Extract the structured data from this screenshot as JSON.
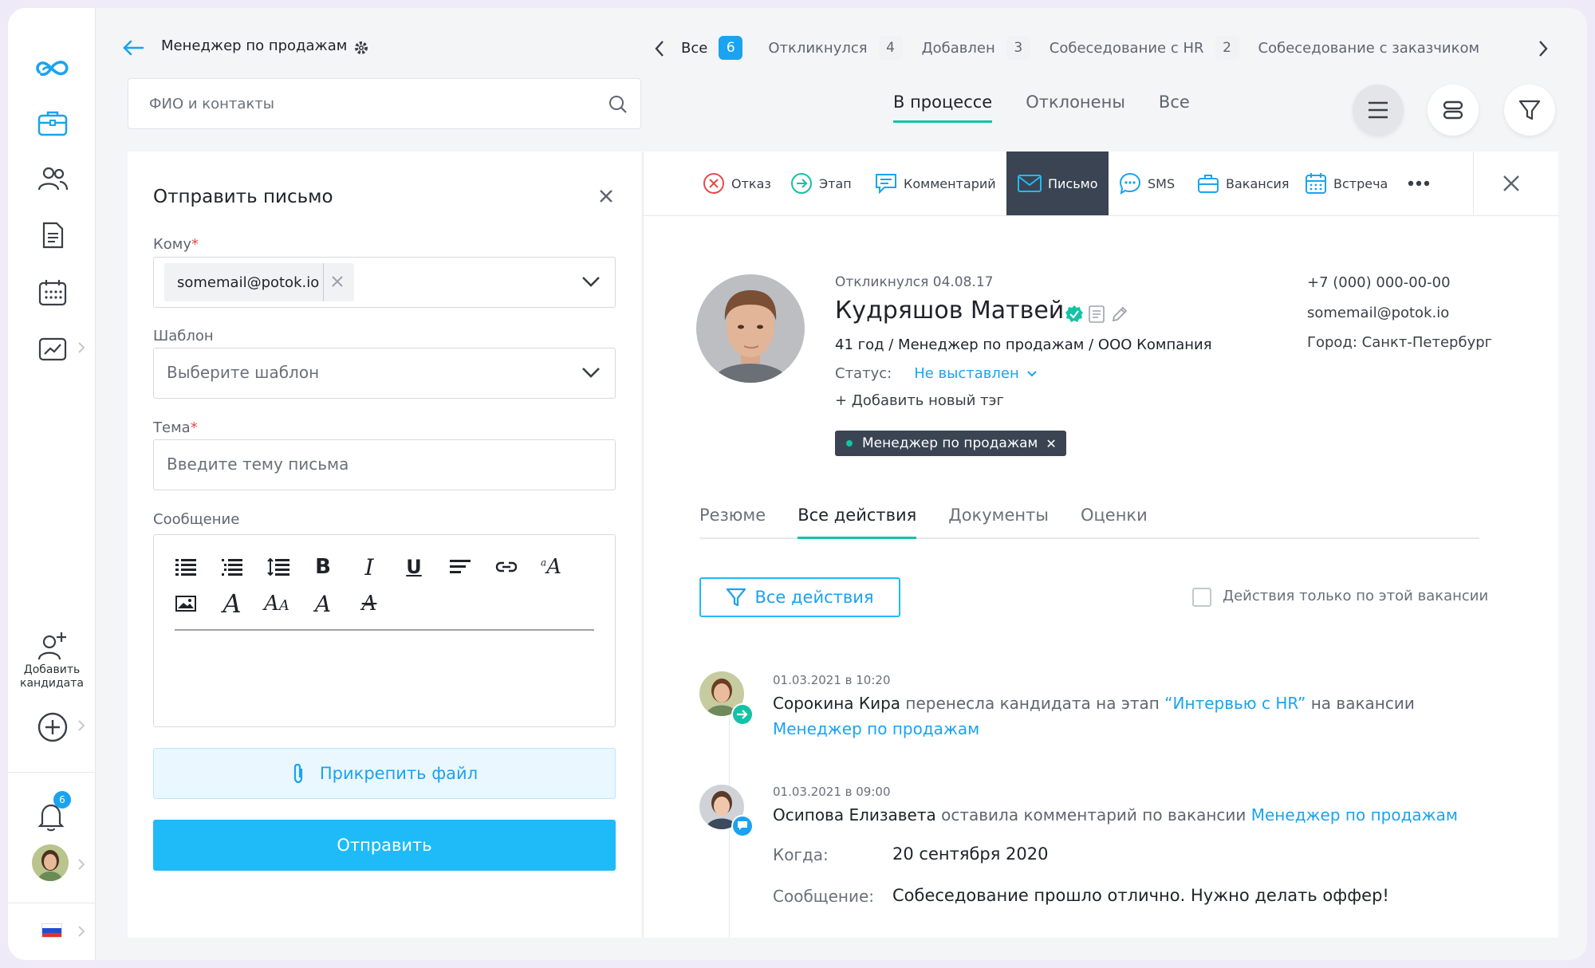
{
  "header": {
    "vacancy_title": "Менеджер по продажам",
    "stages": [
      {
        "label": "Все",
        "count": "6"
      },
      {
        "label": "Откликнулся",
        "count": "4"
      },
      {
        "label": "Добавлен",
        "count": "3"
      },
      {
        "label": "Собеседование с HR",
        "count": "2"
      },
      {
        "label": "Собеседование с заказчиком"
      }
    ],
    "search_placeholder": "ФИО и контакты",
    "process_tabs": [
      "В процессе",
      "Отклонены",
      "Все"
    ]
  },
  "sidebar": {
    "add_candidate_label_1": "Добавить",
    "add_candidate_label_2": "кандидата",
    "notifications_count": "6"
  },
  "email_form": {
    "title": "Отправить письмо",
    "to_label": "Кому",
    "to_value": "somemail@potok.io",
    "template_label": "Шаблон",
    "template_placeholder": "Выберите шаблон",
    "subject_label": "Тема",
    "subject_placeholder": "Введите тему письма",
    "message_label": "Сообщение",
    "attach_label": "Прикрепить файл",
    "send_label": "Отправить"
  },
  "toolbar": {
    "reject": "Отказ",
    "stage": "Этап",
    "comment": "Комментарий",
    "letter": "Письмо",
    "sms": "SMS",
    "vacancy": "Вакансия",
    "meeting": "Встреча"
  },
  "candidate": {
    "responded": "Откликнулся 04.08.17",
    "name": "Кудряшов Матвей",
    "subtitle": "41 год / Менеджер по продажам / ООО Компания",
    "status_label": "Статус:",
    "status_value": "Не выставлен",
    "add_tag": "+ Добавить новый тэг",
    "vacancy_tag": "Менеджер по продажам",
    "phone": "+7 (000) 000-00-00",
    "email": "somemail@potok.io",
    "city": "Город: Санкт-Петербург"
  },
  "candidate_tabs": [
    "Резюме",
    "Все действия",
    "Документы",
    "Оценки"
  ],
  "actions_filter": {
    "button_label": "Все действия",
    "checkbox_label": "Действия только по этой вакансии"
  },
  "activity": [
    {
      "date": "01.03.2021 в 10:20",
      "author": "Сорокина Кира",
      "text1": " перенесла кандидата на этап ",
      "stage_link": "“Интервью с HR”",
      "text2": " на вакансии",
      "vacancy_link": "Менеджер по продажам"
    },
    {
      "date": "01.03.2021 в 09:00",
      "author": "Осипова Елизавета",
      "text1": " оставила комментарий по вакансии ",
      "vacancy_link": "Менеджер по продажам",
      "when_label": "Когда:",
      "when_value": "20 сентября 2020",
      "message_label": "Сообщение:",
      "message_value": "Собеседование прошло отлично. Нужно делать оффер!"
    }
  ],
  "colors": {
    "accent_blue": "#1aa3f0",
    "accent_teal": "#14c2a6",
    "dark_toolbar": "#3a4452",
    "send_button": "#1fbbf8"
  }
}
